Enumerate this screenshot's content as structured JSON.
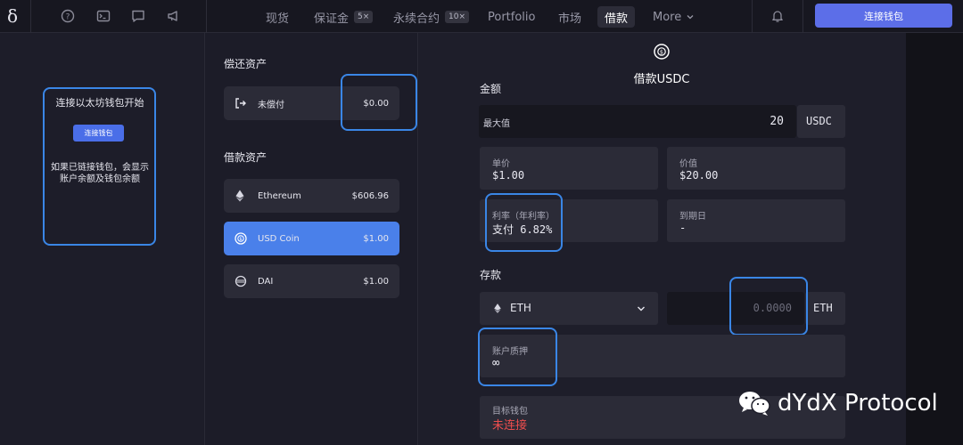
{
  "topbar": {
    "logo": "δ",
    "nav": [
      {
        "label": "现货",
        "badge": ""
      },
      {
        "label": "保证金",
        "badge": "5×"
      },
      {
        "label": "永续合约",
        "badge": "10×"
      },
      {
        "label": "Portfolio",
        "badge": ""
      },
      {
        "label": "市场",
        "badge": ""
      },
      {
        "label": "借款",
        "badge": ""
      },
      {
        "label": "More",
        "badge": ""
      }
    ],
    "connect_label": "连接钱包"
  },
  "left": {
    "title": "连接以太坊钱包开始",
    "button": "连接钱包",
    "desc": "如果已链接钱包，会显示账户余额及钱包余额"
  },
  "mid": {
    "repay_title": "偿还资产",
    "repay": {
      "label": "未偿付",
      "value": "$0.00"
    },
    "borrow_title": "借款资产",
    "assets": [
      {
        "name": "Ethereum",
        "value": "$606.96",
        "icon": "ethereum-icon"
      },
      {
        "name": "USD Coin",
        "value": "$1.00",
        "icon": "usdc-icon"
      },
      {
        "name": "DAI",
        "value": "$1.00",
        "icon": "dai-icon"
      }
    ]
  },
  "right": {
    "title": "借款USDC",
    "amount_label": "金额",
    "max_label": "最大值",
    "amount_value": "20",
    "amount_unit": "USDC",
    "price_label": "单价",
    "price_value": "$1.00",
    "value_label": "价值",
    "value_value": "$20.00",
    "rate_label": "利率（年利率）",
    "rate_value": "支付 6.82%",
    "expiry_label": "到期日",
    "expiry_value": "-",
    "deposit_label": "存款",
    "deposit_asset": "ETH",
    "deposit_placeholder": "0.0000",
    "deposit_unit": "ETH",
    "collateral_label": "账户质押",
    "collateral_value": "∞",
    "target_label": "目标钱包",
    "target_value": "未连接"
  },
  "watermark": "dYdX Protocol",
  "colors": {
    "accent": "#5c6ee8",
    "highlight": "#3a86e6",
    "error": "#ee4e4e"
  }
}
